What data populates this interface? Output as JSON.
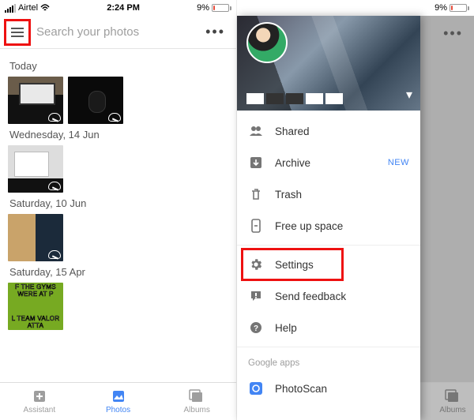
{
  "status": {
    "carrier": "Airtel",
    "time": "2:24 PM",
    "battery_pct": "9%"
  },
  "left": {
    "search_placeholder": "Search your photos",
    "sections": [
      {
        "title": "Today"
      },
      {
        "title": "Wednesday, 14 Jun"
      },
      {
        "title": "Saturday, 10 Jun"
      },
      {
        "title": "Saturday, 15 Apr"
      }
    ],
    "meme": {
      "top": "F THE GYMS WERE AT P",
      "bottom": "L TEAM VALOR ATTA"
    },
    "tabs": {
      "assistant": "Assistant",
      "photos": "Photos",
      "albums": "Albums"
    }
  },
  "right": {
    "tabs": {
      "albums": "Albums"
    },
    "menu": {
      "shared": "Shared",
      "archive": "Archive",
      "archive_badge": "NEW",
      "trash": "Trash",
      "free_up": "Free up space",
      "settings": "Settings",
      "feedback": "Send feedback",
      "help": "Help",
      "google_apps": "Google apps",
      "photoscan": "PhotoScan"
    }
  }
}
